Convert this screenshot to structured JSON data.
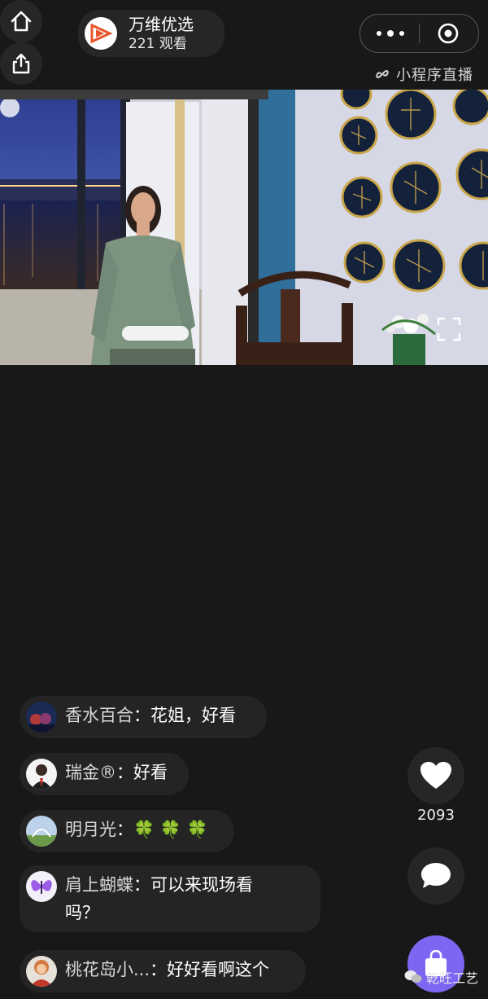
{
  "header": {
    "streamer_name": "万维优选",
    "view_count": "221 观看",
    "mini_program_tag": "小程序直播"
  },
  "comments": [
    {
      "user": "香水百合",
      "separator": "：",
      "message": "花姐，好看"
    },
    {
      "user": "瑞金®",
      "separator": "：",
      "message": "好看"
    },
    {
      "user": "明月光",
      "separator": "：",
      "message": "🍀 🍀 🍀"
    },
    {
      "user": "肩上蝴蝶",
      "separator": "：",
      "message": "可以来现场看",
      "message_line2": "吗？"
    },
    {
      "user": "桃花岛小...",
      "separator": "：",
      "message": "好好看啊这个"
    }
  ],
  "like_count": "2093",
  "watermark": "乾旺工艺",
  "colors": {
    "background": "#181818",
    "button_bg": "#262626",
    "shop_accent": "#7d66f2",
    "logo_red": "#e8542b"
  },
  "icons": [
    "home-icon",
    "share-icon",
    "more-icon",
    "target-icon",
    "link-icon",
    "fullscreen-icon",
    "heart-icon",
    "chat-bubble-icon",
    "shopping-bag-icon"
  ]
}
